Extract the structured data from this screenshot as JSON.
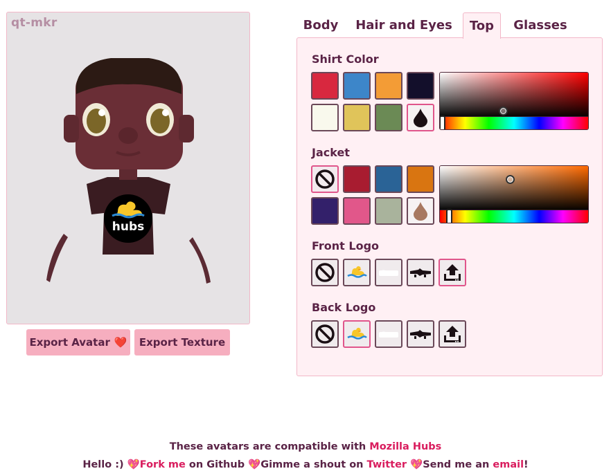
{
  "app": {
    "name": "qt-mkr"
  },
  "export": {
    "avatar_label": "Export Avatar",
    "avatar_emoji": "❤️",
    "texture_label": "Export Texture"
  },
  "tabs": [
    {
      "label": "Body",
      "active": false
    },
    {
      "label": "Hair and Eyes",
      "active": false
    },
    {
      "label": "Top",
      "active": true
    },
    {
      "label": "Glasses",
      "active": false
    }
  ],
  "shirt": {
    "title": "Shirt Color",
    "swatches": [
      "#d8283f",
      "#3d86c9",
      "#f39c36",
      "#130f2b",
      "#f9f9ed",
      "#e0c45a",
      "#6b8a55",
      "custom"
    ],
    "selected": "custom",
    "picker": {
      "hue": 0,
      "handle_color": "#af9c9c"
    }
  },
  "jacket": {
    "title": "Jacket",
    "swatches": [
      "none",
      "#a81c30",
      "#2a6396",
      "#d97511",
      "#33206a",
      "#e1578a",
      "#a9b39c",
      "custom"
    ],
    "selected": "none",
    "picker": {
      "hue": 25,
      "handle_color": "#ab9b8c"
    }
  },
  "front_logo": {
    "title": "Front Logo",
    "options": [
      "none-icon",
      "duck-icon",
      "hubs-icon",
      "gator-icon",
      "upload-icon"
    ],
    "selected": "upload-icon"
  },
  "back_logo": {
    "title": "Back Logo",
    "options": [
      "none-icon",
      "duck-icon",
      "hubs-icon",
      "gator-icon",
      "upload-icon"
    ],
    "selected": "duck-icon"
  },
  "avatar_logo_text": "hubs",
  "footer": {
    "line1_prefix": "These avatars are compatible with ",
    "line1_link": "Mozilla Hubs",
    "hello": "Hello :) ",
    "fork": "Fork me",
    "on_github": " on Github ",
    "gimme": "Gimme a shout on ",
    "twitter": "Twitter",
    "send": "Send me an ",
    "email": "email",
    "bang": "!",
    "heart": "💖"
  }
}
